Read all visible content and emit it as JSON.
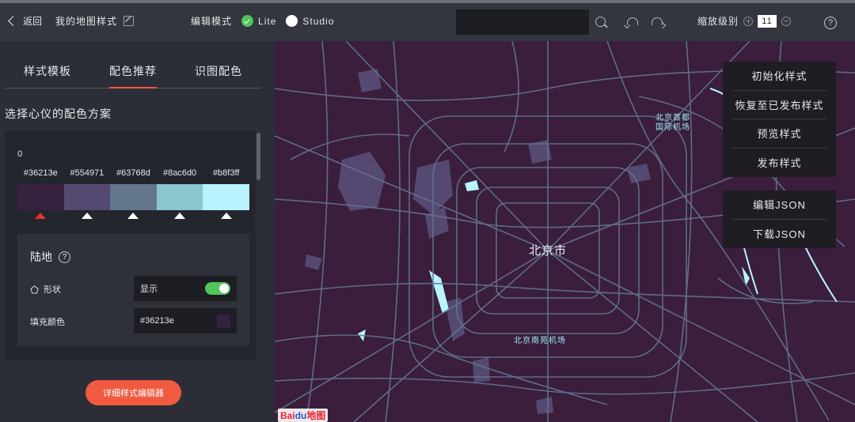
{
  "topbar": {
    "back_label": "返回",
    "map_name": "我的地图样式",
    "mode_label": "编辑模式",
    "mode_lite": "Lite",
    "mode_studio": "Studio",
    "search_value": "",
    "zoom_label": "缩放级别",
    "zoom_value": "11",
    "help_glyph": "?"
  },
  "sidebar": {
    "tabs": [
      {
        "label": "样式模板"
      },
      {
        "label": "配色推荐"
      },
      {
        "label": "识图配色"
      }
    ],
    "active_tab": 1,
    "subtitle": "选择心仪的配色方案",
    "palette": {
      "index": "0",
      "colors": [
        "#36213e",
        "#554971",
        "#63768d",
        "#8ac6d0",
        "#b8f3ff"
      ],
      "selected": 0
    },
    "land": {
      "title": "陆地",
      "help_glyph": "?",
      "shape_label": "形状",
      "shape_value": "显示",
      "fill_label": "填充颜色",
      "fill_value": "#36213e"
    },
    "detail_button": "详细样式编辑器"
  },
  "map": {
    "labels": {
      "city": "北京市",
      "airport_line1": "北京首都",
      "airport_line2": "国际机场",
      "south_airport": "北京南苑机场"
    },
    "menu_group1": [
      "初始化样式",
      "恢复至已发布样式",
      "预览样式",
      "发布样式"
    ],
    "menu_group2": [
      "编辑JSON",
      "下载JSON"
    ],
    "logo_bai": "Bai",
    "logo_du": "du",
    "logo_cn": "地图",
    "colors": {
      "land": "#3a1e3c",
      "road": "#63768d",
      "green": "#554971",
      "water": "#b8f3ff"
    }
  },
  "colors": {
    "accent": "#f05a40",
    "toggle_on": "#52c45a"
  }
}
